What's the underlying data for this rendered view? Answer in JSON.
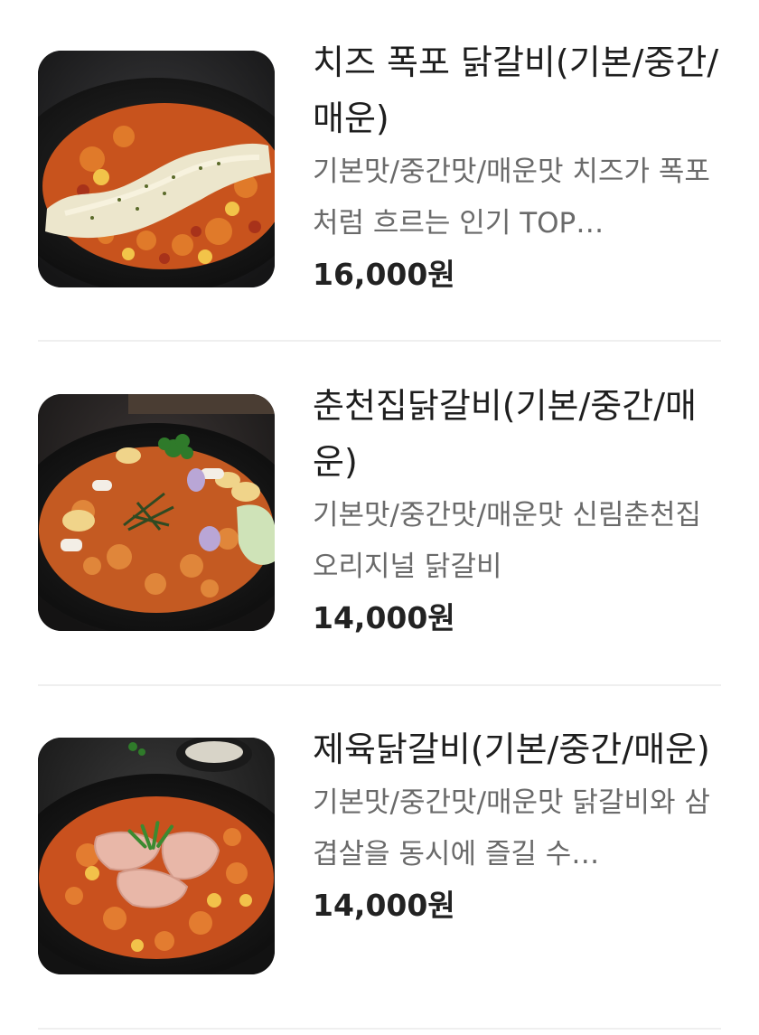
{
  "menu": {
    "items": [
      {
        "name": "치즈 폭포 닭갈비(기본/중간/매운)",
        "description": "기본맛/중간맛/매운맛 치즈가 폭포처럼 흐르는 인기 TOP…",
        "price": "16,000원",
        "image": "cheese-dakgalbi-photo"
      },
      {
        "name": "춘천집닭갈비(기본/중간/매운)",
        "description": "기본맛/중간맛/매운맛 신림춘천집 오리지널 닭갈비",
        "price": "14,000원",
        "image": "chuncheon-dakgalbi-photo"
      },
      {
        "name": "제육닭갈비(기본/중간/매운)",
        "description": "기본맛/중간맛/매운맛 닭갈비와 삼겹살을 동시에 즐길 수…",
        "price": "14,000원",
        "image": "pork-dakgalbi-photo"
      }
    ]
  },
  "colors": {
    "background": "#ffffff",
    "title_text": "#1e1e1e",
    "description_text": "#6a6a6a",
    "price_text": "#222222",
    "divider": "#efefef"
  }
}
